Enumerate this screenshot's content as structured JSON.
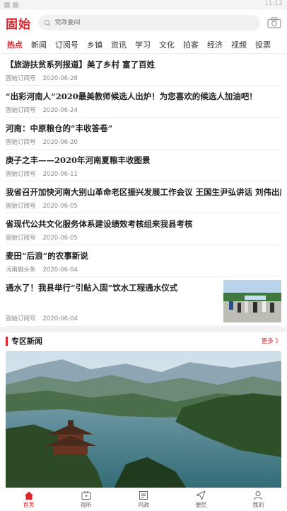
{
  "status": {
    "time": "11:12"
  },
  "header": {
    "logo": "固始",
    "search_placeholder": "党政要闻"
  },
  "tabs": [
    "热点",
    "新闻",
    "订阅号",
    "乡镇",
    "资讯",
    "学习",
    "文化",
    "拍客",
    "经济",
    "视频",
    "投票"
  ],
  "news": [
    {
      "title": "【旅游扶贫系列报道】美了乡村 富了百姓",
      "source": "固始订阅号",
      "date": "2020-06-28"
    },
    {
      "title": "“出彩河南人”2020最美教师候选人出炉！为您喜欢的候选人加油吧！",
      "source": "固始订阅号",
      "date": "2020-06-24"
    },
    {
      "title": "河南：中原粮仓的“丰收答卷”",
      "source": "固始订阅号",
      "date": "2020-06-20"
    },
    {
      "title": "庚子之丰——2020年河南夏粮丰收图景",
      "source": "固始订阅号",
      "date": "2020-06-11"
    },
    {
      "title": "我省召开加快河南大别山革命老区振兴发展工作会议 王国生尹弘讲话 刘伟出席",
      "source": "固始订阅号",
      "date": "2020-06-05"
    },
    {
      "title": "省现代公共文化服务体系建设绩效考核组来我县考核",
      "source": "固始订阅号",
      "date": "2020-06-05"
    },
    {
      "title": "麦田“后浪”的农事新说",
      "source": "河南融头条",
      "date": "2020-06-04"
    },
    {
      "title": "通水了！我县举行“引鲇入固”饮水工程通水仪式",
      "source": "固始订阅号",
      "date": "2020-06-04"
    }
  ],
  "zone": {
    "label": "专区新闻",
    "more": "更多 》"
  },
  "bottom_nav": [
    {
      "label": "首页",
      "icon": "home-icon"
    },
    {
      "label": "视听",
      "icon": "tv-icon"
    },
    {
      "label": "问政",
      "icon": "politics-icon"
    },
    {
      "label": "便民",
      "icon": "send-icon"
    },
    {
      "label": "我的",
      "icon": "user-icon"
    }
  ],
  "colors": {
    "accent": "#d9252b"
  }
}
